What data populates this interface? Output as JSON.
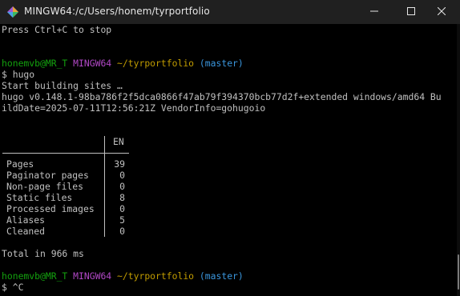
{
  "window": {
    "title": "MINGW64:/c/Users/honem/tyrportfolio",
    "icon": "mingw-diamond-icon",
    "controls": [
      "minimize",
      "maximize",
      "close"
    ]
  },
  "terminal": {
    "lines": {
      "l1": "Press Ctrl+C to stop",
      "p1_user": "honemvb@MR_T",
      "p1_env": "MINGW64",
      "p1_path": "~/tyrportfolio",
      "p1_branch": "(master)",
      "cmd1": "$ hugo",
      "l_build": "Start building sites …",
      "l_ver1": "hugo v0.148.1-98ba786f2f5dca0866f47ab79f394370bcb77d2f+extended windows/amd64 Bu",
      "l_ver2": "ildDate=2025-07-11T12:56:21Z VendorInfo=gohugoio",
      "total": "Total in 966 ms",
      "p2_user": "honemvb@MR_T",
      "p2_env": "MINGW64",
      "p2_path": "~/tyrportfolio",
      "p2_branch": "(master)",
      "cmd2": "$ ^C"
    },
    "table": {
      "header": "EN",
      "rows": [
        {
          "label": "Pages",
          "value": "39"
        },
        {
          "label": "Paginator pages",
          "value": "0"
        },
        {
          "label": "Non-page files",
          "value": "0"
        },
        {
          "label": "Static files",
          "value": "8"
        },
        {
          "label": "Processed images",
          "value": "0"
        },
        {
          "label": "Aliases",
          "value": "5"
        },
        {
          "label": "Cleaned",
          "value": "0"
        }
      ]
    }
  },
  "colors": {
    "prompt_user": "#13a10e",
    "prompt_env": "#b148c6",
    "prompt_path": "#c19c00",
    "prompt_branch": "#3a96dd",
    "text": "#c0c0c0",
    "background": "#000000"
  }
}
